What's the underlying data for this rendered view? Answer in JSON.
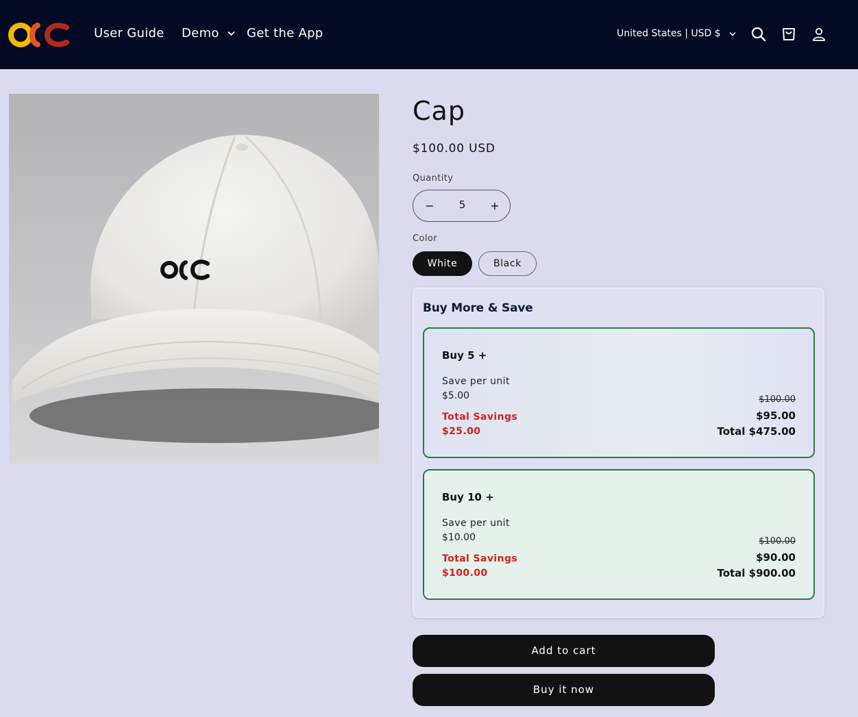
{
  "header": {
    "nav": [
      "User Guide",
      "Demo",
      "Get the App"
    ],
    "region": "United States | USD $",
    "logo_icon": "osc-logo",
    "icons": [
      "search-icon",
      "cart-icon",
      "account-icon"
    ],
    "background": "#020a24"
  },
  "product": {
    "title": "Cap",
    "price": "$100.00 USD",
    "image_icon": "white-baseball-cap-with-osc-logo",
    "quantity": {
      "label": "Quantity",
      "value": "5",
      "minus": "−",
      "plus": "+"
    },
    "color": {
      "label": "Color",
      "options": [
        "White",
        "Black"
      ],
      "selected": "White"
    }
  },
  "bundle": {
    "title": "Buy More & Save",
    "tiers": [
      {
        "heading": "Buy 5 +",
        "save_label": "Save per unit",
        "save_value": "$5.00",
        "total_savings_label": "Total Savings",
        "total_savings_value": "$25.00",
        "original_price": "$100.00",
        "unit_price": "$95.00",
        "total": "Total $475.00"
      },
      {
        "heading": "Buy 10 +",
        "save_label": "Save per unit",
        "save_value": "$10.00",
        "total_savings_label": "Total Savings",
        "total_savings_value": "$100.00",
        "original_price": "$100.00",
        "unit_price": "$90.00",
        "total": "Total $900.00"
      }
    ],
    "accent_green": "#2d7a45",
    "savings_red": "#d42020"
  },
  "actions": {
    "add_to_cart": "Add to cart",
    "buy_now": "Buy it now"
  }
}
